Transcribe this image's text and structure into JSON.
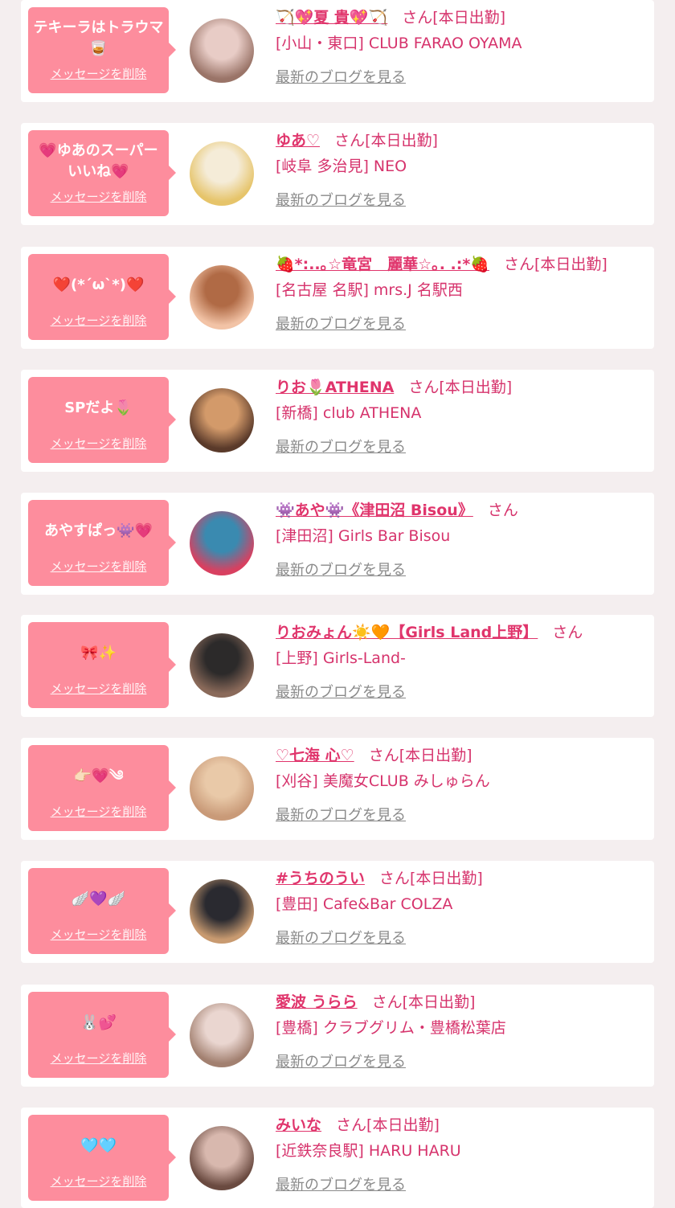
{
  "theme": {
    "page_bg": "#f4eeef",
    "card_bg": "#ffffff",
    "bubble_bg": "#fd8d9d",
    "accent_pink": "#e0356c",
    "muted_link": "#8a8a8a"
  },
  "labels": {
    "delete": "メッセージを削除",
    "blog": "最新のブログを見る"
  },
  "messages": [
    {
      "message": "テキーラはトラウマ🥃",
      "name": "🏹💖夏 貴💖🏹",
      "san": "さん",
      "status": "[本日出勤]",
      "area": "[小山・東口]",
      "shop": "CLUB FARAO OYAMA",
      "avatar": "avatar-photo",
      "colors": [
        "#e8ccc6",
        "#9a7468"
      ]
    },
    {
      "message": "💗ゆあのスーパーいいね💗",
      "name": "ゆあ♡",
      "san": "さん",
      "status": "[本日出勤]",
      "area": "[岐阜 多治見]",
      "shop": "NEO",
      "avatar": "avatar-photo",
      "colors": [
        "#f5ecd8",
        "#e6c46a"
      ]
    },
    {
      "message": "❤️(*´ω`*)❤️",
      "name": "🍓*:..｡☆竜宮　麗華☆｡. .:*🍓",
      "san": "さん",
      "status": "[本日出勤]",
      "area": "[名古屋 名駅]",
      "shop": "mrs.J 名駅西",
      "avatar": "avatar-photo",
      "colors": [
        "#b06a45",
        "#f2c3a6"
      ]
    },
    {
      "message": "SPだよ🌷",
      "name": "りお🌷ATHENA",
      "san": "さん",
      "status": "[本日出勤]",
      "area": "[新橋]",
      "shop": "club ATHENA",
      "avatar": "avatar-photo",
      "colors": [
        "#d39a6a",
        "#5a3a2a"
      ]
    },
    {
      "message": "あやすぱっ👾💗",
      "name": "👾あや👾《津田沼 Bisou》",
      "san": "さん",
      "status": "",
      "area": "[津田沼]",
      "shop": "Girls Bar Bisou",
      "avatar": "avatar-photo",
      "colors": [
        "#3a8ab0",
        "#d84060"
      ]
    },
    {
      "message": "🎀✨",
      "name": "りおみょん☀️🧡【Girls Land上野】",
      "san": "さん",
      "status": "",
      "area": "[上野]",
      "shop": "Girls-Land-",
      "avatar": "avatar-photo",
      "colors": [
        "#2c2a2a",
        "#8a6a5a"
      ]
    },
    {
      "message": "👉🏻💗༄",
      "name": "♡七海 心♡",
      "san": "さん",
      "status": "[本日出勤]",
      "area": "[刈谷]",
      "shop": "美魔女CLUB みしゅらん",
      "avatar": "avatar-photo",
      "colors": [
        "#e9c9a8",
        "#c99a78"
      ]
    },
    {
      "message": "🪽💜🪽",
      "name": "#うちのうい",
      "san": "さん",
      "status": "[本日出勤]",
      "area": "[豊田]",
      "shop": "Cafe&Bar COLZA",
      "avatar": "avatar-photo",
      "colors": [
        "#2a2a30",
        "#c89a70"
      ]
    },
    {
      "message": "🐰💕",
      "name": "愛波 うらら",
      "san": "さん",
      "status": "[本日出勤]",
      "area": "[豊橋]",
      "shop": "クラブグリム・豊橋松葉店",
      "avatar": "avatar-photo",
      "colors": [
        "#ead6d0",
        "#a28070"
      ]
    },
    {
      "message": "🩵🩵",
      "name": "みいな",
      "san": "さん",
      "status": "[本日出勤]",
      "area": "[近鉄奈良駅]",
      "shop": "HARU HARU",
      "avatar": "avatar-photo",
      "colors": [
        "#d8b8ae",
        "#6a4a40"
      ]
    }
  ]
}
